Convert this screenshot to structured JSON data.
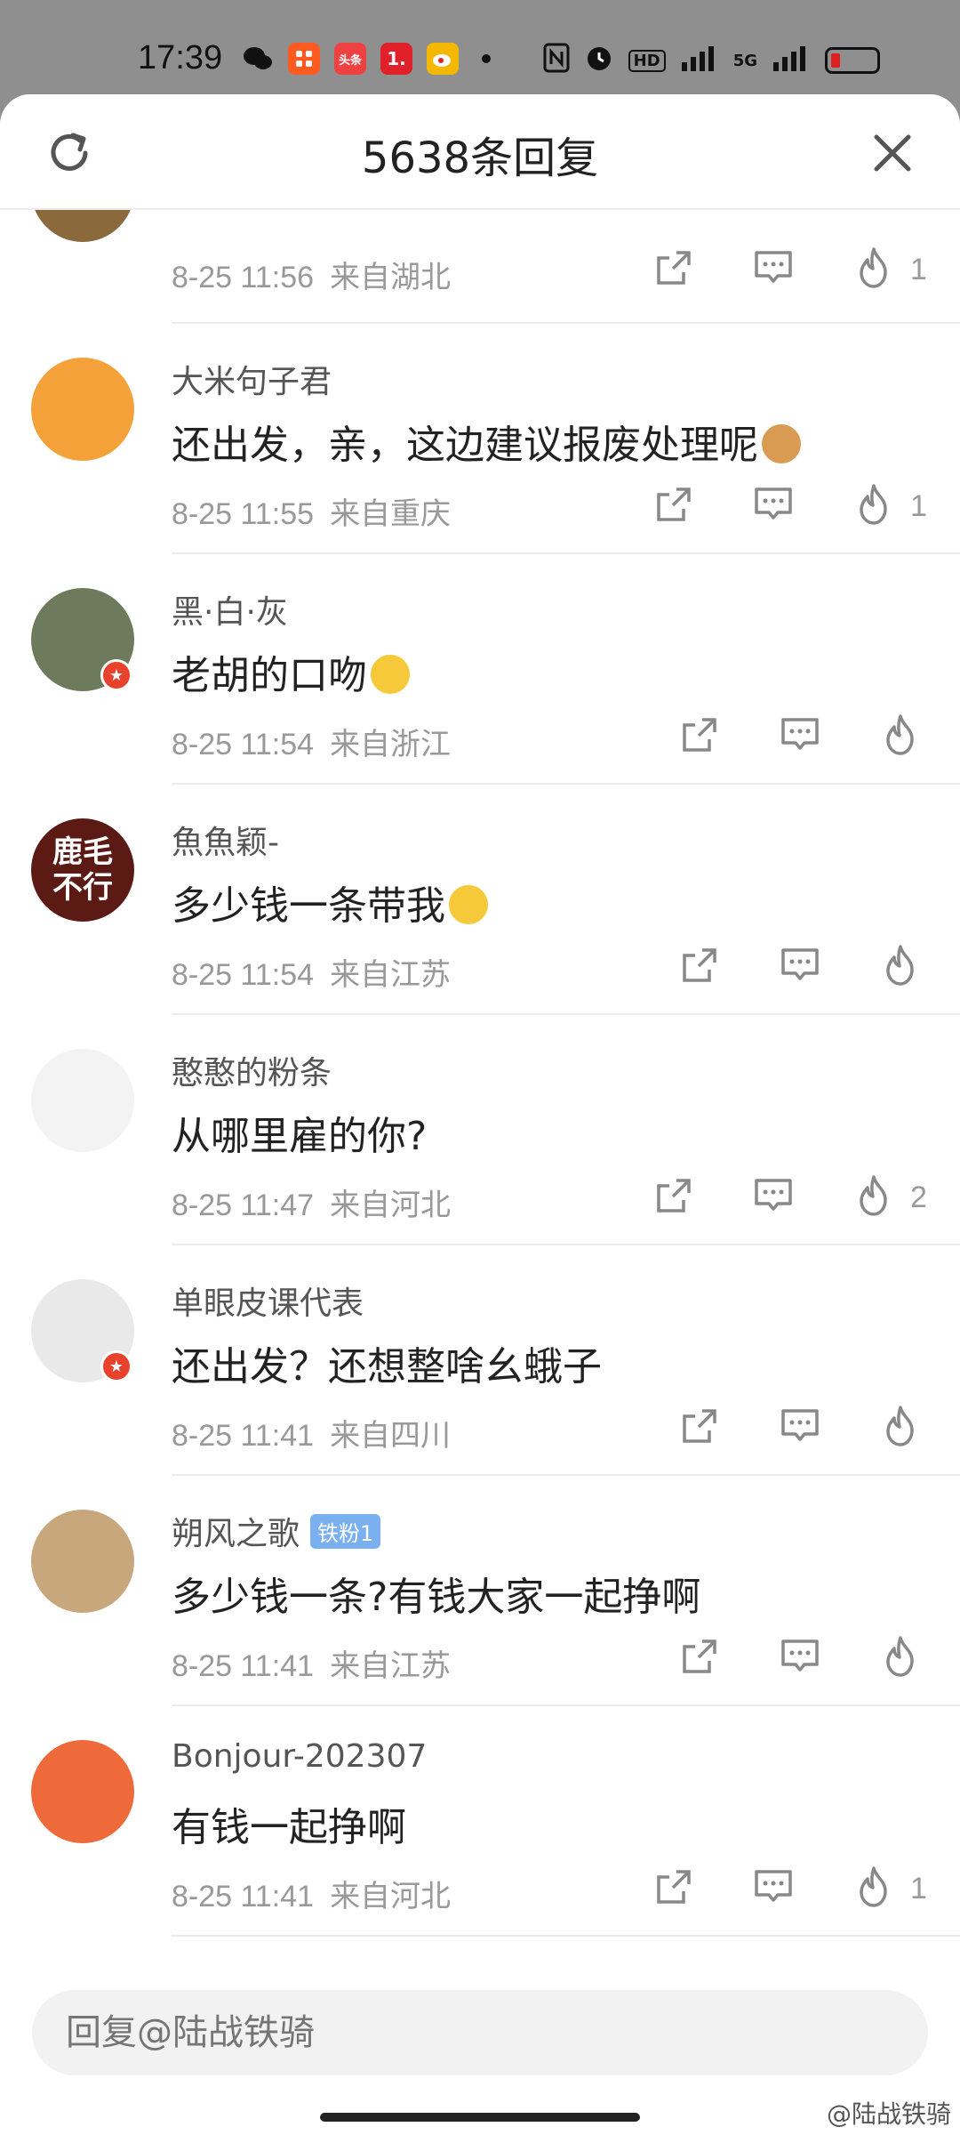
{
  "status_bar": {
    "time": "17:39",
    "apps": [
      {
        "name": "wechat-icon",
        "label": "",
        "color": "#111111"
      },
      {
        "name": "taobao-icon",
        "label": "",
        "color": "#ff5a1f"
      },
      {
        "name": "toutiao-icon",
        "label": "头条",
        "color": "#f04142"
      },
      {
        "name": "app-one-icon",
        "label": "1.",
        "color": "#e0212a"
      },
      {
        "name": "weibo-icon",
        "label": "",
        "color": "#f5b800"
      }
    ],
    "network": "5G",
    "hd_label": "HD"
  },
  "header": {
    "title": "5638条回复"
  },
  "comments": [
    {
      "name": "大米句子君",
      "text": "还出发，亲，这边建议报废处理呢",
      "date": "8-25 11:55",
      "location": "来自重庆",
      "likes": "1",
      "avatar_color": "#f4a13a",
      "verified": false
    },
    {
      "name": "黑·白·灰",
      "text": "老胡的口吻",
      "date": "8-25 11:54",
      "location": "来自浙江",
      "likes": "",
      "avatar_color": "#6d7a5c",
      "verified": true
    },
    {
      "name": "魚魚颖-",
      "text": "多少钱一条带我",
      "date": "8-25 11:54",
      "location": "来自江苏",
      "likes": "",
      "avatar_color": "#5b1a14",
      "avatar_text": "鹿毛不行",
      "verified": false
    },
    {
      "name": "憨憨的粉条",
      "text": "从哪里雇的你?",
      "date": "8-25 11:47",
      "location": "来自河北",
      "likes": "2",
      "avatar_color": "#f3f3f3",
      "verified": false
    },
    {
      "name": "单眼皮课代表",
      "text": "还出发？还想整啥幺蛾子",
      "date": "8-25 11:41",
      "location": "来自四川",
      "likes": "",
      "avatar_color": "#e9e9e9",
      "verified": true
    },
    {
      "name": "朔风之歌",
      "badge": "铁粉1",
      "text": "多少钱一条?有钱大家一起挣啊",
      "date": "8-25 11:41",
      "location": "来自江苏",
      "likes": "",
      "avatar_color": "#c8a77c",
      "verified": false
    },
    {
      "name": "Bonjour-202307",
      "text": "有钱一起挣啊",
      "date": "8-25 11:41",
      "location": "来自河北",
      "likes": "1",
      "avatar_color": "#ef6a3a",
      "verified": false
    }
  ],
  "partial_top": {
    "date": "8-25 11:56",
    "location": "来自湖北",
    "likes": "1"
  },
  "reply": {
    "placeholder": "回复@陆战铁骑"
  },
  "watermark": "@陆战铁骑"
}
